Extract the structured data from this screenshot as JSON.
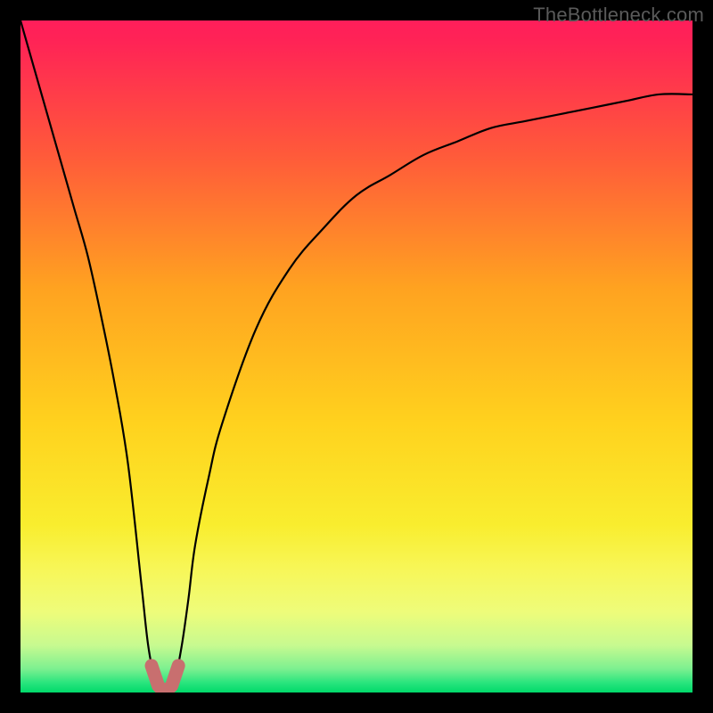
{
  "watermark": "TheBottleneck.com",
  "chart_data": {
    "type": "line",
    "title": "",
    "xlabel": "",
    "ylabel": "",
    "xlim": [
      0,
      100
    ],
    "ylim": [
      0,
      100
    ],
    "grid": false,
    "legend": false,
    "series": [
      {
        "name": "bottleneck-curve",
        "color": "#000000",
        "x": [
          0,
          2,
          4,
          6,
          8,
          10,
          12,
          14,
          16,
          18,
          19,
          20,
          21,
          22,
          23,
          24,
          25,
          26,
          28,
          30,
          35,
          40,
          45,
          50,
          55,
          60,
          65,
          70,
          75,
          80,
          85,
          90,
          95,
          100
        ],
        "y": [
          100,
          93,
          86,
          79,
          72,
          65,
          56,
          46,
          34,
          16,
          7,
          2,
          0,
          0,
          2,
          7,
          14,
          22,
          32,
          40,
          54,
          63,
          69,
          74,
          77,
          80,
          82,
          84,
          85,
          86,
          87,
          88,
          89,
          89
        ]
      },
      {
        "name": "optimal-marker",
        "color": "#c86f6f",
        "x": [
          19.5,
          20.5,
          21.5,
          22.5,
          23.5
        ],
        "y": [
          4,
          1,
          0,
          1,
          4
        ]
      }
    ],
    "background_gradient_stops": [
      {
        "offset": 0.0,
        "color": "#ff1e5a"
      },
      {
        "offset": 0.03,
        "color": "#ff2356"
      },
      {
        "offset": 0.2,
        "color": "#ff5a3a"
      },
      {
        "offset": 0.4,
        "color": "#ffa320"
      },
      {
        "offset": 0.6,
        "color": "#ffd21e"
      },
      {
        "offset": 0.75,
        "color": "#f9ed2e"
      },
      {
        "offset": 0.82,
        "color": "#f7f75a"
      },
      {
        "offset": 0.88,
        "color": "#eefc7a"
      },
      {
        "offset": 0.93,
        "color": "#c7fa90"
      },
      {
        "offset": 0.965,
        "color": "#7cf090"
      },
      {
        "offset": 0.985,
        "color": "#2be57e"
      },
      {
        "offset": 1.0,
        "color": "#00d96a"
      }
    ]
  }
}
